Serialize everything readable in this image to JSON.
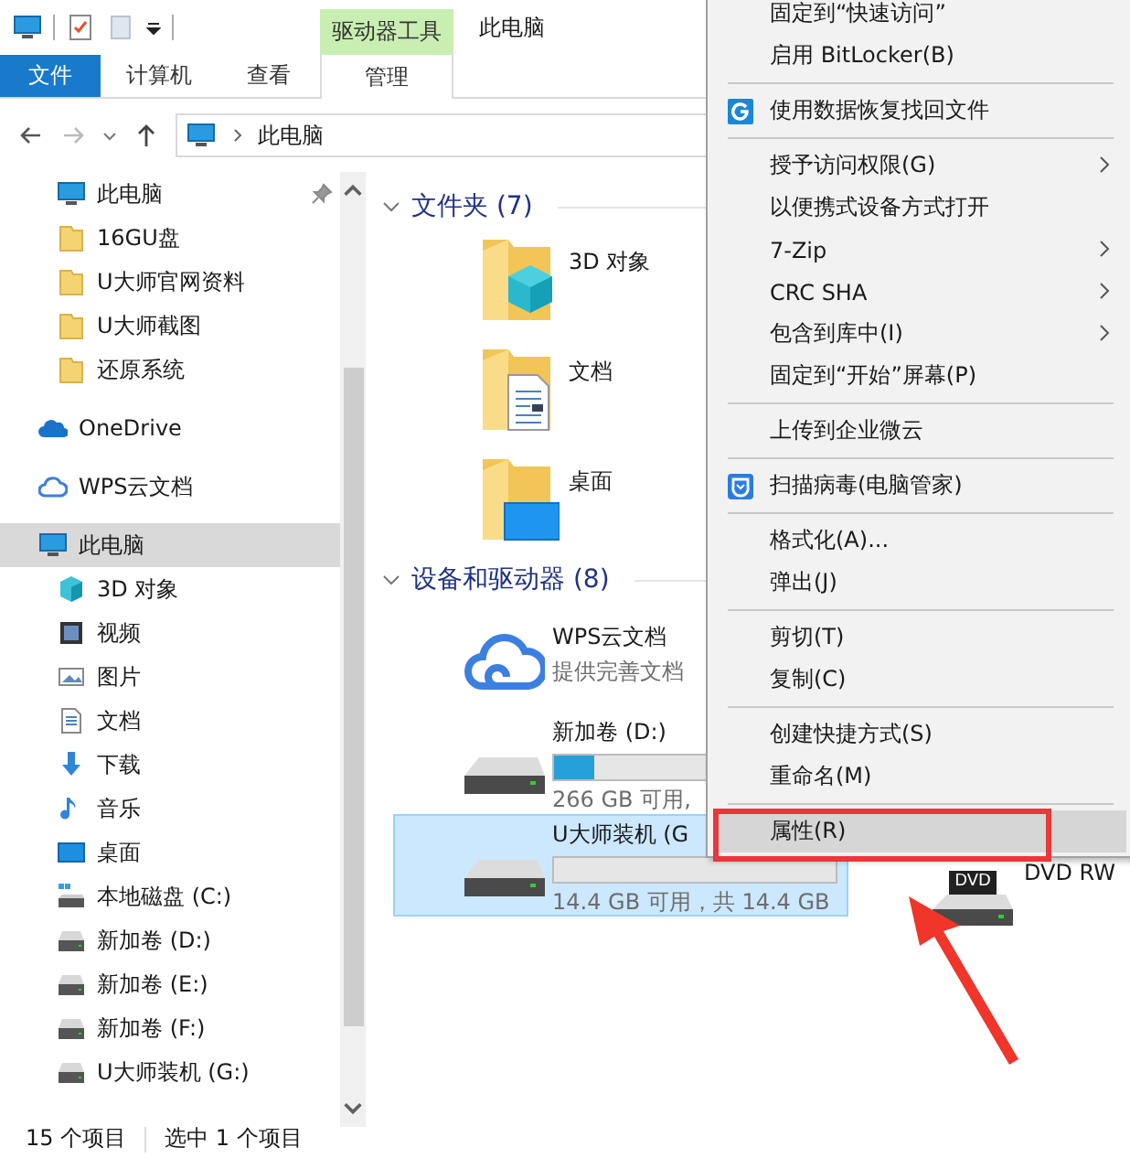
{
  "window": {
    "title": "此电脑",
    "context_tab": "驱动器工具"
  },
  "ribbon_tabs": [
    {
      "label": "文件",
      "kind": "file",
      "selected": false
    },
    {
      "label": "计算机",
      "kind": "tab",
      "selected": false
    },
    {
      "label": "查看",
      "kind": "tab",
      "selected": false
    },
    {
      "label": "管理",
      "kind": "context",
      "selected": false
    }
  ],
  "address": {
    "path": "此电脑"
  },
  "sidebar": {
    "quick_access": [
      {
        "label": "此电脑",
        "kind": "pc",
        "pinned": true,
        "selected": false
      },
      {
        "label": "16GU盘",
        "kind": "folder",
        "pinned": false,
        "selected": false
      },
      {
        "label": "U大师官网资料",
        "kind": "folder",
        "pinned": false,
        "selected": false
      },
      {
        "label": "U大师截图",
        "kind": "folder",
        "pinned": false,
        "selected": false
      },
      {
        "label": "还原系统",
        "kind": "folder",
        "pinned": false,
        "selected": false
      }
    ],
    "items": [
      {
        "label": "OneDrive",
        "kind": "onedrive",
        "selected": false
      },
      {
        "label": "WPS云文档",
        "kind": "wps",
        "selected": false
      },
      {
        "label": "此电脑",
        "kind": "pc",
        "selected": true,
        "children": [
          {
            "label": "3D 对象",
            "kind": "objects",
            "selected": false
          },
          {
            "label": "视频",
            "kind": "video",
            "selected": false
          },
          {
            "label": "图片",
            "kind": "picture",
            "selected": false
          },
          {
            "label": "文档",
            "kind": "doc",
            "selected": false
          },
          {
            "label": "下载",
            "kind": "download",
            "selected": false
          },
          {
            "label": "音乐",
            "kind": "music",
            "selected": false
          },
          {
            "label": "桌面",
            "kind": "desktop",
            "selected": false
          },
          {
            "label": "本地磁盘 (C:)",
            "kind": "system",
            "selected": false
          },
          {
            "label": "新加卷 (D:)",
            "kind": "drive",
            "selected": false
          },
          {
            "label": "新加卷 (E:)",
            "kind": "drive",
            "selected": false
          },
          {
            "label": "新加卷 (F:)",
            "kind": "drive",
            "selected": false
          },
          {
            "label": "U大师装机 (G:)",
            "kind": "drive",
            "selected": false
          }
        ]
      }
    ]
  },
  "folders": {
    "title": "文件夹 (7)",
    "items": [
      {
        "label": "3D 对象",
        "kind": "objects"
      },
      {
        "label": "文档",
        "kind": "doc"
      },
      {
        "label": "桌面",
        "kind": "desktop"
      }
    ]
  },
  "drives": {
    "title": "设备和驱动器 (8)",
    "rows": [
      [
        {
          "kind": "cloud",
          "name": "WPS云文档",
          "subtitle": "提供完善文档",
          "selected": false
        }
      ],
      [
        {
          "kind": "drive",
          "name": "新加卷 (D:)",
          "level": 0.14,
          "free": "266 GB 可用,",
          "selected": false
        }
      ],
      [
        {
          "kind": "drive",
          "name": "U大师装机 (G",
          "level": 0,
          "free": "14.4 GB 可用，共 14.4 GB",
          "selected": true
        },
        {
          "kind": "optical",
          "name": "DVD RW",
          "badge": "DVD",
          "selected": false
        }
      ]
    ]
  },
  "context_menu": {
    "items": [
      {
        "kind": "item",
        "label": "固定到“快速访问”",
        "submenu": false,
        "selected": false
      },
      {
        "kind": "item",
        "label": "启用 BitLocker(B)",
        "submenu": false,
        "selected": false
      },
      {
        "kind": "separator"
      },
      {
        "kind": "recovery",
        "label": "使用数据恢复找回文件",
        "submenu": false,
        "selected": false
      },
      {
        "kind": "separator"
      },
      {
        "kind": "item",
        "label": "授予访问权限(G)",
        "submenu": true,
        "selected": false
      },
      {
        "kind": "item",
        "label": "以便携式设备方式打开",
        "submenu": false,
        "selected": false
      },
      {
        "kind": "item",
        "label": "7-Zip",
        "submenu": true,
        "selected": false
      },
      {
        "kind": "item",
        "label": "CRC SHA",
        "submenu": true,
        "selected": false
      },
      {
        "kind": "item",
        "label": "包含到库中(I)",
        "submenu": true,
        "selected": false
      },
      {
        "kind": "item",
        "label": "固定到“开始”屏幕(P)",
        "submenu": false,
        "selected": false
      },
      {
        "kind": "separator"
      },
      {
        "kind": "item",
        "label": "上传到企业微云",
        "submenu": false,
        "selected": false
      },
      {
        "kind": "separator"
      },
      {
        "kind": "antivirus",
        "label": "扫描病毒(电脑管家)",
        "submenu": false,
        "selected": false
      },
      {
        "kind": "separator"
      },
      {
        "kind": "item",
        "label": "格式化(A)...",
        "submenu": false,
        "selected": false
      },
      {
        "kind": "item",
        "label": "弹出(J)",
        "submenu": false,
        "selected": false
      },
      {
        "kind": "separator"
      },
      {
        "kind": "item",
        "label": "剪切(T)",
        "submenu": false,
        "selected": false
      },
      {
        "kind": "item",
        "label": "复制(C)",
        "submenu": false,
        "selected": false
      },
      {
        "kind": "separator"
      },
      {
        "kind": "item",
        "label": "创建快捷方式(S)",
        "submenu": false,
        "selected": false
      },
      {
        "kind": "item",
        "label": "重命名(M)",
        "submenu": false,
        "selected": false
      },
      {
        "kind": "separator"
      },
      {
        "kind": "item",
        "label": "属性(R)",
        "submenu": false,
        "selected": true,
        "highlighted": true
      }
    ]
  },
  "status_bar": {
    "count": "15 个项目",
    "selection": "选中 1 个项目"
  }
}
